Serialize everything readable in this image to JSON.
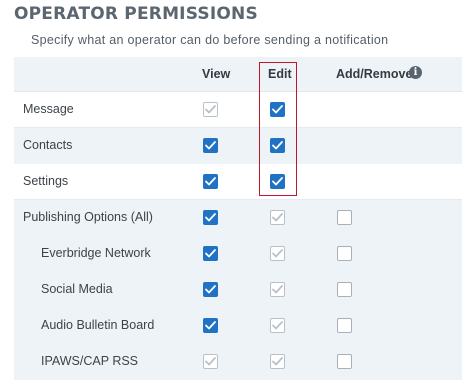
{
  "title": "OPERATOR PERMISSIONS",
  "subtitle": "Specify what an operator can do before sending a notification",
  "columns": {
    "view": "View",
    "edit": "Edit",
    "add_remove": "Add/Remove"
  },
  "info_icon": "info-icon",
  "highlight_color": "#c0162a",
  "checkbox_color": "#1f72c4",
  "rows": [
    {
      "label": "Message",
      "indent": 0,
      "view": "disabled",
      "edit": "checked",
      "add_remove": "none"
    },
    {
      "label": "Contacts",
      "indent": 0,
      "view": "checked",
      "edit": "checked",
      "add_remove": "none"
    },
    {
      "label": "Settings",
      "indent": 0,
      "view": "checked",
      "edit": "checked",
      "add_remove": "none"
    },
    {
      "label": "Publishing Options (All)",
      "indent": 0,
      "view": "checked",
      "edit": "disabled",
      "add_remove": "unchecked"
    },
    {
      "label": "Everbridge Network",
      "indent": 1,
      "view": "checked",
      "edit": "disabled",
      "add_remove": "unchecked"
    },
    {
      "label": "Social Media",
      "indent": 1,
      "view": "checked",
      "edit": "disabled",
      "add_remove": "unchecked"
    },
    {
      "label": "Audio Bulletin Board",
      "indent": 1,
      "view": "checked",
      "edit": "disabled",
      "add_remove": "unchecked"
    },
    {
      "label": "IPAWS/CAP RSS",
      "indent": 1,
      "view": "disabled",
      "edit": "disabled",
      "add_remove": "unchecked"
    }
  ]
}
